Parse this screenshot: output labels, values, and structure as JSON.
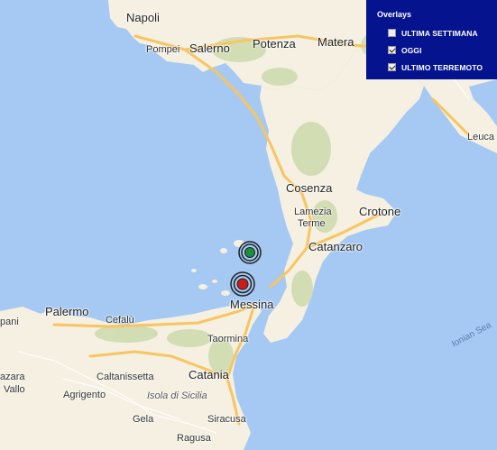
{
  "map": {
    "places": [
      {
        "key": "napoli",
        "label": "Napoli",
        "size": "big"
      },
      {
        "key": "pompei",
        "label": "Pompei"
      },
      {
        "key": "salerno",
        "label": "Salerno",
        "size": "big"
      },
      {
        "key": "potenza",
        "label": "Potenza",
        "size": "big"
      },
      {
        "key": "matera",
        "label": "Matera",
        "size": "big"
      },
      {
        "key": "leuca",
        "label": "Leuca"
      },
      {
        "key": "cosenza",
        "label": "Cosenza",
        "size": "big"
      },
      {
        "key": "lamezia",
        "label": "Lamezia"
      },
      {
        "key": "terme",
        "label": "Terme"
      },
      {
        "key": "crotone",
        "label": "Crotone",
        "size": "big"
      },
      {
        "key": "catanzaro",
        "label": "Catanzaro",
        "size": "big"
      },
      {
        "key": "messina",
        "label": "Messina",
        "size": "big"
      },
      {
        "key": "palermo",
        "label": "Palermo",
        "size": "big"
      },
      {
        "key": "cefalu",
        "label": "Cefalù"
      },
      {
        "key": "taormina",
        "label": "Taormina"
      },
      {
        "key": "caltanissetta",
        "label": "Caltanissetta"
      },
      {
        "key": "catania",
        "label": "Catania",
        "size": "big"
      },
      {
        "key": "agrigento",
        "label": "Agrigento"
      },
      {
        "key": "isola",
        "label": "Isola di Sicilia",
        "size": "island"
      },
      {
        "key": "gela",
        "label": "Gela"
      },
      {
        "key": "siracusa",
        "label": "Siracusa"
      },
      {
        "key": "ragusa",
        "label": "Ragusa"
      },
      {
        "key": "pani",
        "label": "pani"
      },
      {
        "key": "azara",
        "label": "azara"
      },
      {
        "key": "vallo",
        "label": "Vallo"
      },
      {
        "key": "ionian",
        "label": "Ionian Sea",
        "size": "sea"
      }
    ],
    "markers": [
      {
        "key": "oggi",
        "label": "OGGI",
        "color": "#1a8f3c"
      },
      {
        "key": "ultimo",
        "label": "ULTIMO TERREMOTO",
        "color": "#cc1b1b"
      }
    ]
  },
  "overlays": {
    "title": "Overlays",
    "items": [
      {
        "label": "ULTIMA SETTIMANA",
        "checked": false
      },
      {
        "label": "OGGI",
        "checked": true
      },
      {
        "label": "ULTIMO TERREMOTO",
        "checked": true
      }
    ]
  },
  "colors": {
    "sea": "#a5c9f3",
    "land": "#f5f0e1",
    "panel": "#06138f"
  }
}
